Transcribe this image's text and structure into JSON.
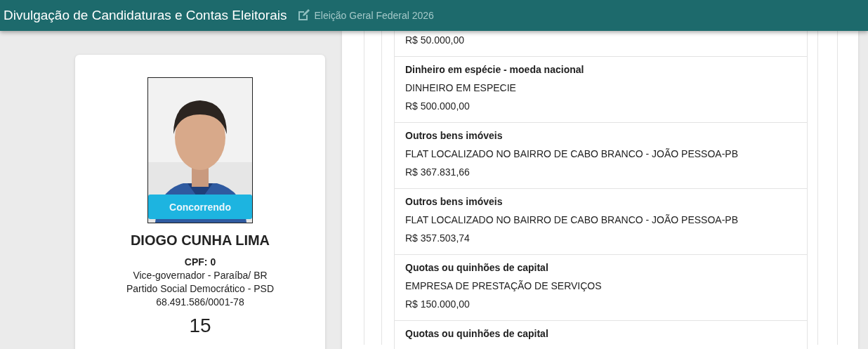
{
  "header": {
    "title": "Divulgação de Candidaturas e Contas Eleitorais",
    "election": "Eleição Geral Federal 2026"
  },
  "candidate": {
    "status": "Concorrendo",
    "name": "DIOGO CUNHA LIMA",
    "cpf": "CPF: 0",
    "office": "Vice-governador - Paraíba/ BR",
    "party": "Partido Social Democrático - PSD",
    "cnpj": "68.491.586/0001-78",
    "number": "15"
  },
  "assets": [
    {
      "value": "R$ 50.000,00"
    },
    {
      "title": "Dinheiro em espécie - moeda nacional",
      "description": "DINHEIRO EM ESPECIE",
      "value": "R$ 500.000,00"
    },
    {
      "title": "Outros bens imóveis",
      "description": "FLAT LOCALIZADO NO BAIRRO DE CABO BRANCO - JOÃO PESSOA-PB",
      "value": "R$ 367.831,66"
    },
    {
      "title": "Outros bens imóveis",
      "description": "FLAT LOCALIZADO NO BAIRRO DE CABO BRANCO - JOÃO PESSOA-PB",
      "value": "R$ 357.503,74"
    },
    {
      "title": "Quotas ou quinhões de capital",
      "description": "EMPRESA DE PRESTAÇÃO DE SERVIÇOS",
      "value": "R$ 150.000,00"
    },
    {
      "title": "Quotas ou quinhões de capital"
    }
  ]
}
